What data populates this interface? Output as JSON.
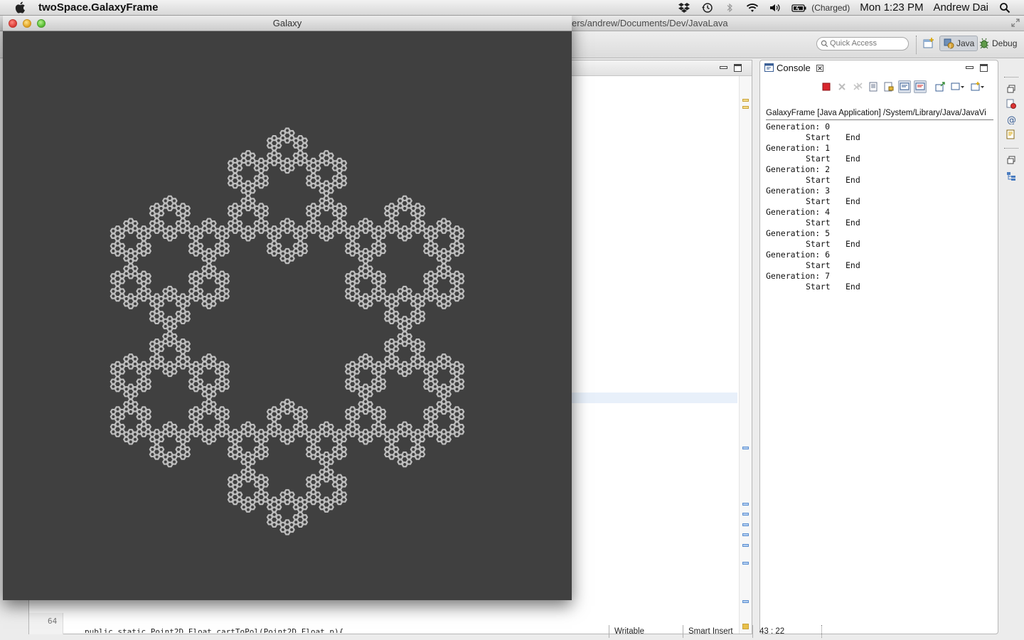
{
  "menubar": {
    "app_name": "twoSpace.GalaxyFrame",
    "battery_status": "(Charged)",
    "clock": "Mon 1:23 PM",
    "user": "Andrew Dai",
    "status_icons": [
      "dropbox-icon",
      "time-machine-icon",
      "bluetooth-icon",
      "wifi-icon",
      "volume-icon",
      "battery-icon",
      "spotlight-icon"
    ]
  },
  "eclipse": {
    "title_path": "ers/andrew/Documents/Dev/JavaLava",
    "quick_access_placeholder": "Quick Access",
    "perspectives": [
      "Java",
      "Debug"
    ],
    "active_perspective": "Java",
    "editor": {
      "visible_line_number": "64",
      "visible_code": "public static Point2D.Float cartToPol(Point2D.Float p){"
    },
    "console": {
      "tab_label": "Console",
      "description": "GalaxyFrame [Java Application] /System/Library/Java/JavaVi",
      "generations": [
        {
          "label": "Generation: 0",
          "start": "Start",
          "end": "End"
        },
        {
          "label": "Generation: 1",
          "start": "Start",
          "end": "End"
        },
        {
          "label": "Generation: 2",
          "start": "Start",
          "end": "End"
        },
        {
          "label": "Generation: 3",
          "start": "Start",
          "end": "End"
        },
        {
          "label": "Generation: 4",
          "start": "Start",
          "end": "End"
        },
        {
          "label": "Generation: 5",
          "start": "Start",
          "end": "End"
        },
        {
          "label": "Generation: 6",
          "start": "Start",
          "end": "End"
        },
        {
          "label": "Generation: 7",
          "start": "Start",
          "end": "End"
        }
      ]
    },
    "statusbar": {
      "writable": "Writable",
      "insert_mode": "Smart Insert",
      "cursor_position": "43 : 22"
    }
  },
  "galaxy_window": {
    "title": "Galaxy",
    "background_color": "#404040",
    "fractal_color": "#bdbdbd",
    "fractal_generation": 7
  }
}
